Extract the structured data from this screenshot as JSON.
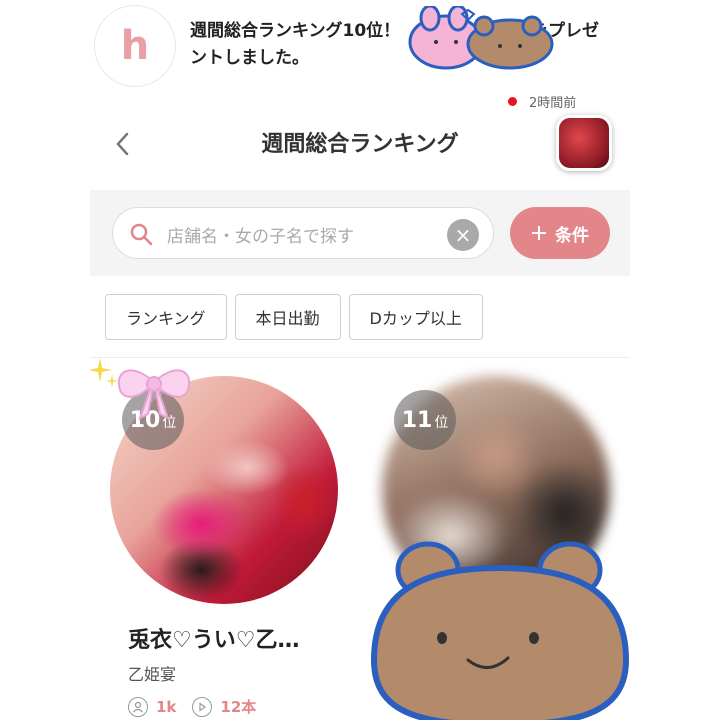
{
  "notification": {
    "logo_letter": "h",
    "text": "週間総合ランキング10位！                    Pをプレゼントしました。",
    "time": "2時間前"
  },
  "header": {
    "title": "週間総合ランキング"
  },
  "search": {
    "placeholder": "店舗名・女の子名で探す",
    "condition_label": "条件"
  },
  "chips": [
    "ランキング",
    "本日出勤",
    "Dカップ以上"
  ],
  "cards": [
    {
      "rank": "10",
      "rank_suffix": "位",
      "name": "兎衣♡うい♡乙…",
      "shop": "乙姫宴",
      "followers": "1k",
      "videos": "12本"
    },
    {
      "rank": "11",
      "rank_suffix": "位"
    }
  ],
  "colors": {
    "accent": "#e3868a",
    "notification_dot": "#e6141e"
  }
}
